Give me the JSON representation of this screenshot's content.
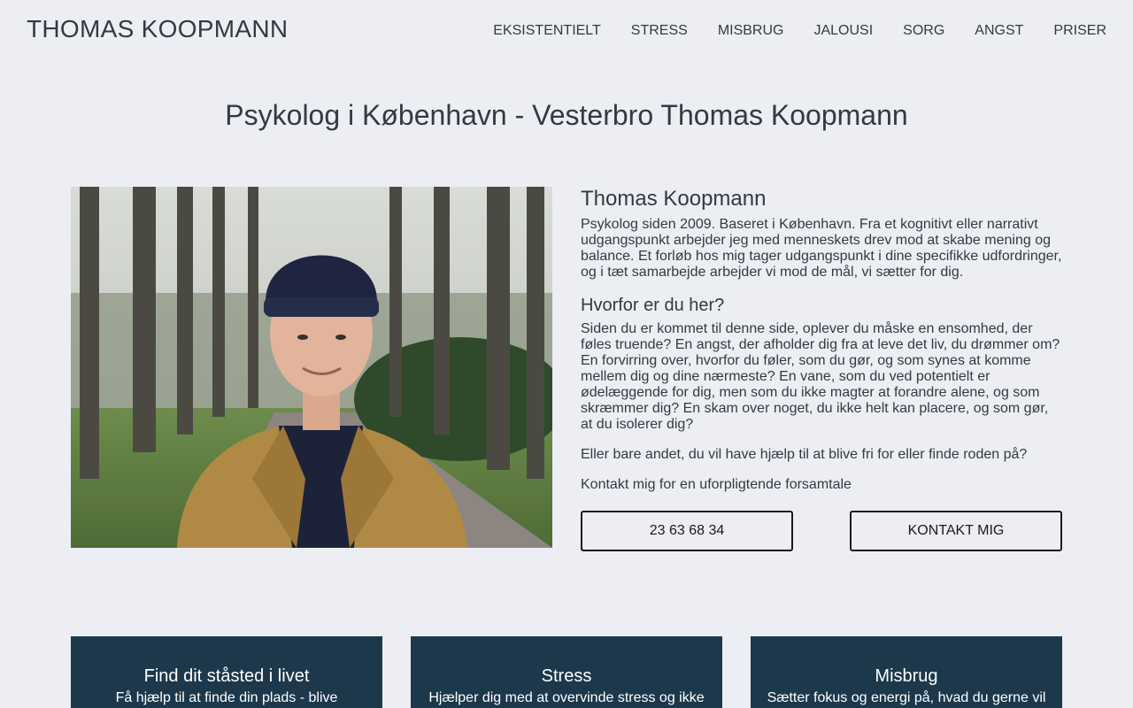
{
  "brand": "THOMAS KOOPMANN",
  "nav": [
    "EKSISTENTIELT",
    "STRESS",
    "MISBRUG",
    "JALOUSI",
    "SORG",
    "ANGST",
    "PRISER"
  ],
  "page_title": "Psykolog i København - Vesterbro Thomas Koopmann",
  "profile": {
    "name": "Thomas Koopmann",
    "bio": "Psykolog siden 2009. Baseret i København. Fra et kognitivt eller narrativt udgangspunkt arbejder jeg med menneskets drev mod at skabe mening og balance. Et forløb hos mig tager udgangspunkt i dine specifikke udfordringer, og i tæt samarbejde arbejder vi mod de mål, vi sætter for dig."
  },
  "why": {
    "heading": "Hvorfor er du her?",
    "text": "Siden du er kommet til denne side, oplever du måske en ensomhed, der føles truende? En angst, der afholder dig fra at leve det liv, du drømmer om? En forvirring over, hvorfor du føler, som du gør, og som synes at komme mellem dig og dine nærmeste? En vane, som du ved potentielt er ødelæggende for dig, men som du ikke magter at forandre alene, og som skræmmer dig? En skam over noget, du ikke helt kan placere, og som gør, at du isolerer dig?",
    "extra": "Eller bare andet, du vil have hjælp til at blive fri for eller finde roden på?",
    "cta_text": "Kontakt mig for en uforpligtende forsamtale"
  },
  "buttons": {
    "phone": "23 63 68 34",
    "contact": "KONTAKT MIG"
  },
  "cards": [
    {
      "title": "Find dit ståsted i livet",
      "desc": "Få hjælp til at finde din plads - blive"
    },
    {
      "title": "Stress",
      "desc": "Hjælper dig med at overvinde stress og ikke"
    },
    {
      "title": "Misbrug",
      "desc": "Sætter fokus og energi på, hvad du gerne vil"
    }
  ],
  "colors": {
    "background": "#eceef3",
    "text": "#343a40",
    "card": "#1d384b"
  }
}
